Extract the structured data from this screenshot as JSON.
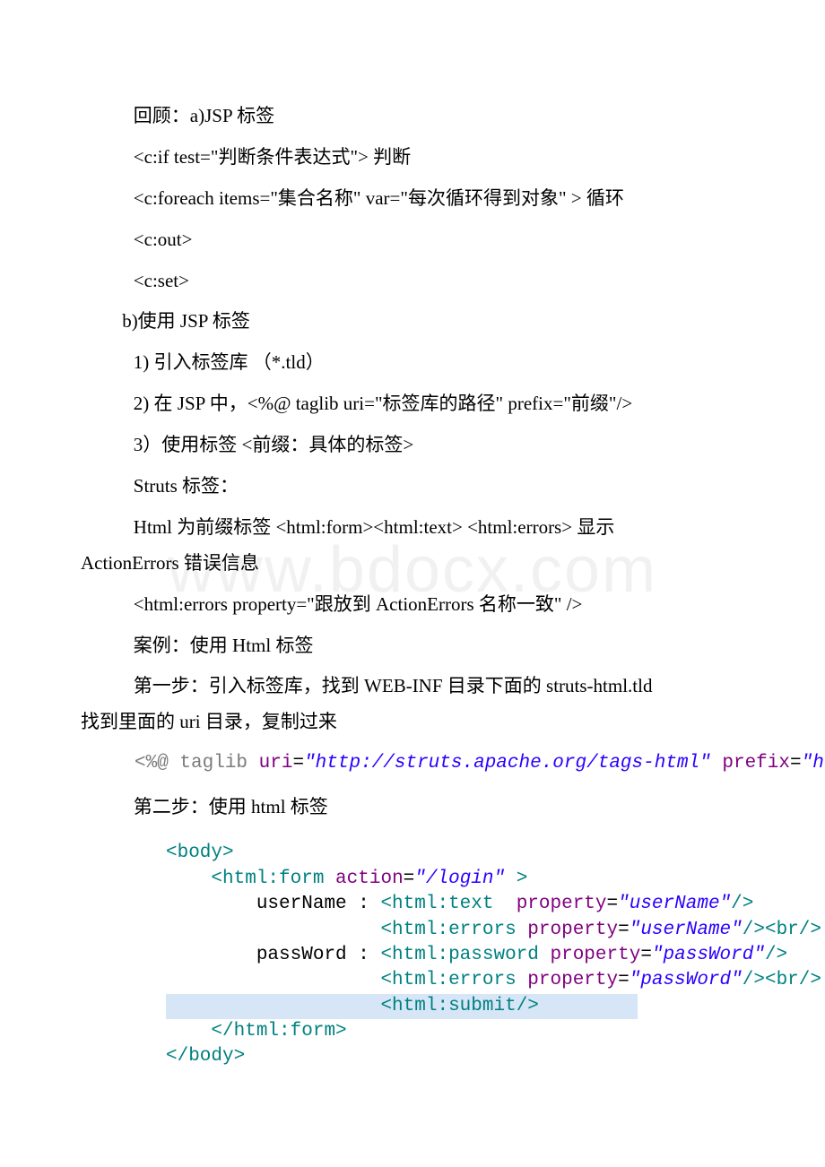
{
  "watermark": "www.bdocx.com",
  "lines": {
    "l1": "回顾：a)JSP 标签",
    "l2": " <c:if test=\"判断条件表达式\"> 判断",
    "l3": " <c:foreach items=\"集合名称\" var=\"每次循环得到对象\" > 循环",
    "l4": " <c:out>",
    "l5": " <c:set>",
    "l6": "b)使用 JSP 标签",
    "l7": " 1) 引入标签库 （*.tld）",
    "l8": " 2) 在 JSP 中，<%@ taglib uri=\"标签库的路径\" prefix=\"前缀\"/>",
    "l9": " 3）使用标签 <前缀：具体的标签>",
    "l10": "Struts 标签：",
    "l11a": " Html 为前缀标签 <html:form><html:text> <html:errors> 显示",
    "l11b": "ActionErrors 错误信息",
    "l12": "<html:errors property=\"跟放到 ActionErrors 名称一致\" />",
    "l13": "案例：使用 Html 标签",
    "l14a": "第一步：引入标签库，找到 WEB-INF 目录下面的 struts-html.tld",
    "l14b": "找到里面的 uri 目录，复制过来",
    "l15": "第二步：使用 html 标签"
  },
  "code1": {
    "open": "<%@",
    "taglib": " taglib ",
    "uriK": "uri",
    "eq": "=",
    "uriV": "\"http://struts.apache.org/tags-html\"",
    "sp": " ",
    "prefixK": "prefix",
    "prefixV": "\"html\"",
    "close": "%>"
  },
  "code2": {
    "bodyOpen": "<body>",
    "formOpen1": "<html:form",
    "formAttr": " action",
    "formVal": "\"/login\"",
    "formOpen2": " >",
    "userLabel": "userName : ",
    "textOpen": "<html:text",
    "propAttr": "  property",
    "userVal": "\"userName\"",
    "selfClose": "/>",
    "errOpen": "<html:errors",
    "propAttr2": " property",
    "brOpen": "<br",
    "passLabel": "passWord : ",
    "pwdOpen": "<html:password",
    "passVal": "\"passWord\"",
    "submitOpen": "<html:submit",
    "submitClose": "/>",
    "formClose": "</html:form>",
    "bodyClose": "</body>"
  }
}
